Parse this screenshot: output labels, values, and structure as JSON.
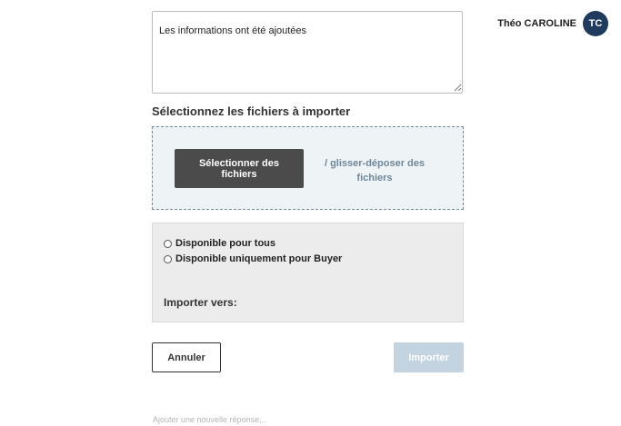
{
  "user": {
    "name": "Théo CAROLINE",
    "initials": "TC",
    "avatar_color": "#1f3a5c"
  },
  "comment": {
    "value": "Les informations ont été ajoutées"
  },
  "upload": {
    "title": "Sélectionnez les fichiers à importer",
    "select_button": "Sélectionner des fichiers",
    "drag_text": "/ glisser-déposer des fichiers"
  },
  "options": {
    "radio_all": "Disponible pour tous",
    "radio_buyer": "Disponible uniquement pour Buyer",
    "import_to_label": "Importer vers:"
  },
  "actions": {
    "cancel": "Annuler",
    "import": "Importer",
    "import_color": "#c4d3e0"
  },
  "reply": {
    "placeholder": "Ajouter une nouvelle réponse..."
  }
}
